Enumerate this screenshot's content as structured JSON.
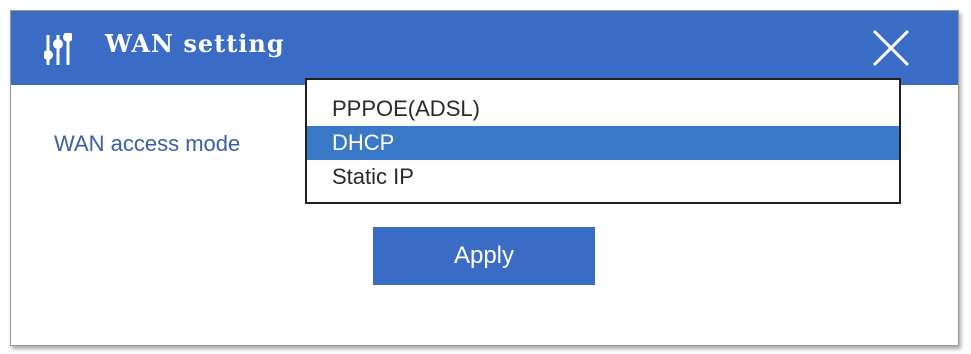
{
  "window": {
    "title": "WAN setting",
    "title_icon": "sliders-icon",
    "close_icon": "close-icon"
  },
  "form": {
    "access_mode_label": "WAN access mode",
    "access_mode_options": [
      "PPPOE(ADSL)",
      "DHCP",
      "Static IP"
    ],
    "access_mode_highlighted": "DHCP"
  },
  "actions": {
    "apply_label": "Apply"
  },
  "colors": {
    "titlebar": "#3a6cc6",
    "highlight": "#3a78c8",
    "label_text": "#3b5fa5",
    "button": "#3a6cc6"
  }
}
